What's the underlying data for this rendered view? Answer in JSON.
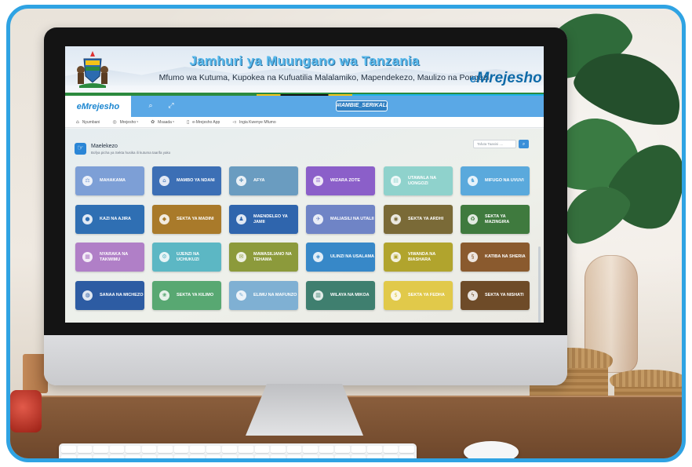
{
  "banner": {
    "title": "Jamhuri ya Muungano wa Tanzania",
    "subtitle": "Mfumo wa Kutuma, Kupokea na Kufuatilia Malalamiko, Mapendekezo, Maulizo na Pongezi",
    "logo_prefix": "e",
    "logo_rest": "Mrejesho"
  },
  "topbar": {
    "brand": "eMrejesho",
    "hashtag": "#IAMBIE_SERIKALI"
  },
  "nav": [
    {
      "icon": "home-icon",
      "glyph": "⌂",
      "label": "Nyumbani"
    },
    {
      "icon": "chat-icon",
      "glyph": "◎",
      "label": "Mrejesho ᵛ"
    },
    {
      "icon": "help-icon",
      "glyph": "✿",
      "label": "Msaada ᵛ"
    },
    {
      "icon": "phone-icon",
      "glyph": "▯",
      "label": "e-Mrejesho App"
    },
    {
      "icon": "megaphone-icon",
      "glyph": "◅",
      "label": "Ingia Kwenye Mfumo"
    }
  ],
  "main": {
    "title": "Maelekezo",
    "description": "Bofya picha ya Sekta husika ili kutuma taarifa yako",
    "search_placeholder": "Tafuta Taasisi ....",
    "search_button_icon": "search-icon"
  },
  "sectors": [
    {
      "label": "MAHAKAMA",
      "color": "#7d9fd6",
      "glyph": "⚖"
    },
    {
      "label": "MAMBO YA NDANI",
      "color": "#3c6fb5",
      "glyph": "⌂"
    },
    {
      "label": "AFYA",
      "color": "#6a9cc0",
      "glyph": "✚"
    },
    {
      "label": "WIZARA ZOTE",
      "color": "#8b5fc9",
      "glyph": "☰"
    },
    {
      "label": "UTAWALA NA UONGOZI",
      "color": "#8fd2cc",
      "glyph": "▤"
    },
    {
      "label": "MIFUGO NA UVUVI",
      "color": "#5aa9dc",
      "glyph": "♞"
    },
    {
      "label": "KAZI NA AJIRA",
      "color": "#2f6fb3",
      "glyph": "●"
    },
    {
      "label": "SEKTA YA MADINI",
      "color": "#a97a2a",
      "glyph": "◆"
    },
    {
      "label": "MAENDELEO YA JAMII",
      "color": "#2f65ad",
      "glyph": "♟"
    },
    {
      "label": "MALIASILI NA UTALII",
      "color": "#6f84c6",
      "glyph": "✈"
    },
    {
      "label": "SEKTA YA ARDHI",
      "color": "#7a6a37",
      "glyph": "◉"
    },
    {
      "label": "SEKTA YA MAZINGIRA",
      "color": "#3f7a3e",
      "glyph": "♻"
    },
    {
      "label": "NYARAKA NA TAKWIMU",
      "color": "#b07fc7",
      "glyph": "▦"
    },
    {
      "label": "UJENZI NA UCHUKUZI",
      "color": "#5cb7c4",
      "glyph": "⚙"
    },
    {
      "label": "MAWASILIANO NA TEHAMA",
      "color": "#8c9a3b",
      "glyph": "✉"
    },
    {
      "label": "ULINZI NA USALAMA",
      "color": "#3788c8",
      "glyph": "◈"
    },
    {
      "label": "VIWANDA NA BIASHARA",
      "color": "#b1a42d",
      "glyph": "▣"
    },
    {
      "label": "KATIBA NA SHERIA",
      "color": "#8a5a2e",
      "glyph": "§"
    },
    {
      "label": "SANAA NA MICHEZO",
      "color": "#2d5ca3",
      "glyph": "◍"
    },
    {
      "label": "SEKTA YA KILIMO",
      "color": "#58a872",
      "glyph": "❀"
    },
    {
      "label": "ELIMU NA MAFUNZO",
      "color": "#7fb0d3",
      "glyph": "✎"
    },
    {
      "label": "WILAYA NA MIKOA",
      "color": "#3f7f6f",
      "glyph": "▥"
    },
    {
      "label": "SEKTA YA FEDHA",
      "color": "#e1c94a",
      "glyph": "$"
    },
    {
      "label": "SEKTA YA NISHATI",
      "color": "#6e4b28",
      "glyph": "ϟ"
    }
  ],
  "colors": {
    "frame_border": "#2fa3e3",
    "topbar": "#5aa8e6",
    "brand_text": "#1b86d0"
  }
}
